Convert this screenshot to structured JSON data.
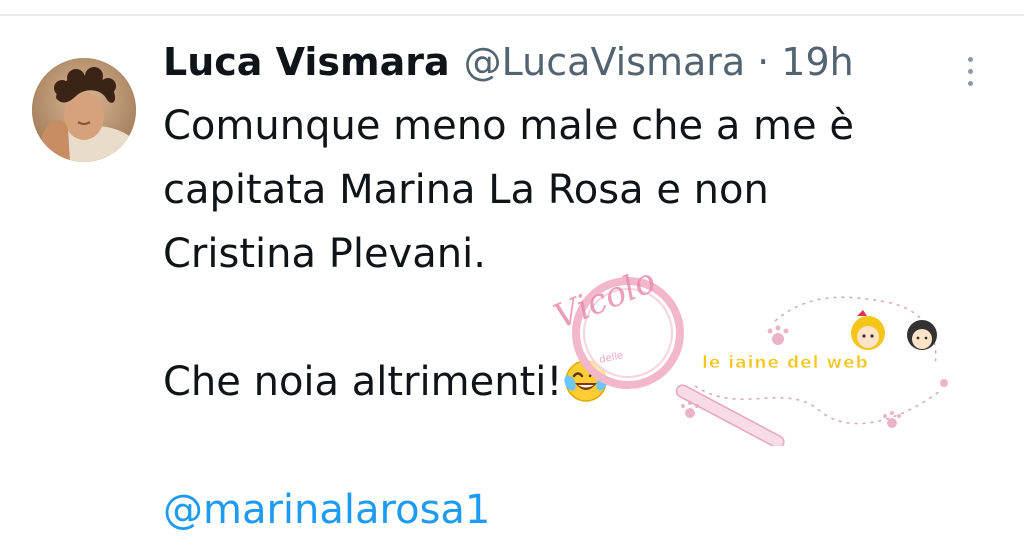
{
  "tweet": {
    "author_name": "Luca Vismara",
    "author_handle": "@LucaVismara",
    "separator": "·",
    "timestamp": "19h",
    "lines": [
      "Comunque meno male che a me è",
      "capitata Marina La Rosa e non",
      "Cristina Plevani.",
      "",
      "Che noia altrimenti!",
      ""
    ],
    "mention": "@marinalarosa1",
    "emoji": "face-with-tears-of-joy-icon"
  },
  "icons": {
    "more": "more-vertical-icon",
    "avatar": "avatar"
  },
  "watermark": {
    "brand_logo_text": "Vicolo delle",
    "slogan_logo_text": "le iaine del web"
  },
  "colors": {
    "text": "#0f1419",
    "secondary": "#536471",
    "link": "#1d9bf0",
    "watermark_pink": "#e89ab8",
    "watermark_yellow": "#f5c518"
  }
}
